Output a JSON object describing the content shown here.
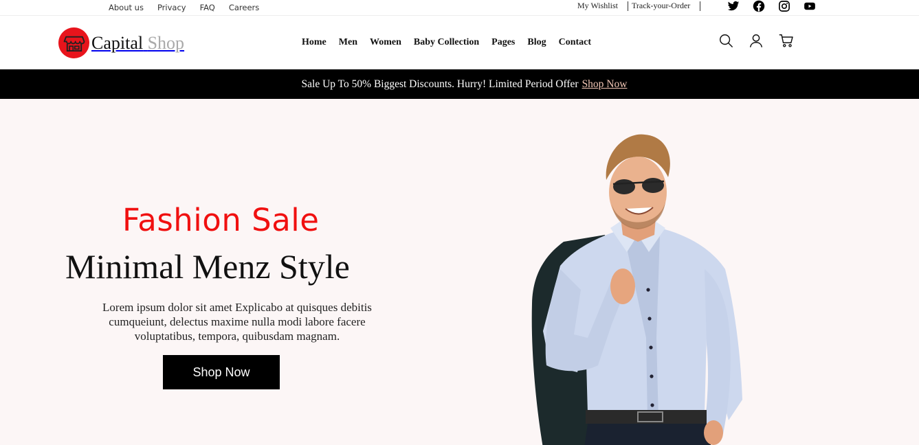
{
  "topbar": {
    "left_links": [
      "About us",
      "Privacy",
      "FAQ",
      "Careers"
    ],
    "wishlist": "My Wishlist",
    "track": "Track-your-Order",
    "social_icons": [
      "twitter-icon",
      "facebook-icon",
      "instagram-icon",
      "youtube-icon"
    ]
  },
  "header": {
    "logo_word1": "Capital",
    "logo_word2": "Shop",
    "nav": [
      "Home",
      "Men",
      "Women",
      "Baby Collection",
      "Pages",
      "Blog",
      "Contact"
    ],
    "icons": [
      "search-icon",
      "user-icon",
      "cart-icon"
    ]
  },
  "salebar": {
    "text": "Sale Up To 50% Biggest Discounts. Hurry! Limited Period Offer",
    "link": "Shop Now"
  },
  "hero": {
    "kicker": "Fashion Sale",
    "title": "Minimal Menz Style",
    "text": "Lorem ipsum dolor sit amet Explicabo at quisques debitis cumqueiunt, delectus maxime nulla modi labore facere voluptatibus, tempora, quibusdam magnam.",
    "button": "Shop Now"
  },
  "colors": {
    "accent_red": "#f01010",
    "logo_red": "#e8141c",
    "hero_bg": "#fcf6f6",
    "salebar_bg": "#000000"
  }
}
